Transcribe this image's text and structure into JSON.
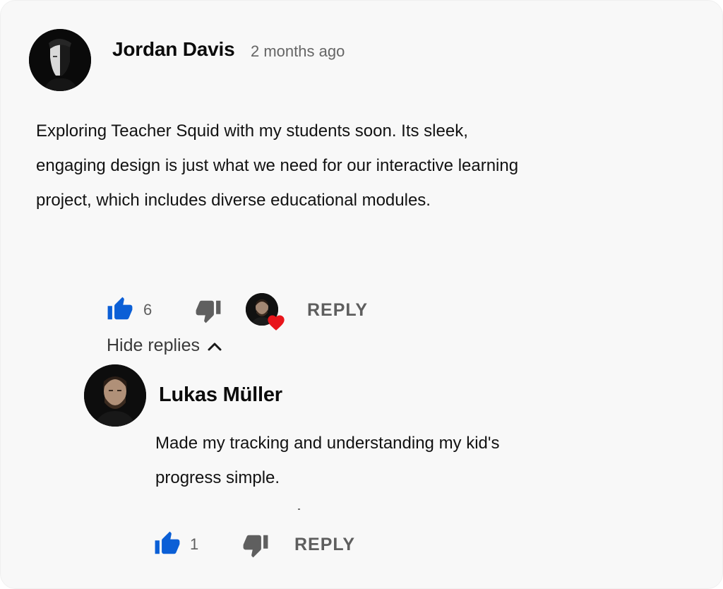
{
  "comment": {
    "author": "Jordan Davis",
    "timestamp": "2 months ago",
    "text_lines": [
      "Exploring Teacher Squid with my students soon. Its sleek,",
      "engaging design is just what we need for our interactive learning",
      "project, which includes diverse educational modules."
    ],
    "like_count": "6",
    "reply_label": "REPLY",
    "hide_replies_label": "Hide replies"
  },
  "reply": {
    "author": "Lukas Müller",
    "text_lines": [
      "Made my tracking and understanding my kid's",
      "progress simple."
    ],
    "like_count": "1",
    "reply_label": "REPLY"
  },
  "icons": {
    "like": "thumbs-up-icon",
    "dislike": "thumbs-down-icon",
    "heart": "heart-icon",
    "chevron": "chevron-up-icon"
  },
  "colors": {
    "like_active": "#0b5fd6",
    "dislike": "#5f5f5f",
    "heart": "#e8151b",
    "card_bg": "#f8f8f8"
  }
}
